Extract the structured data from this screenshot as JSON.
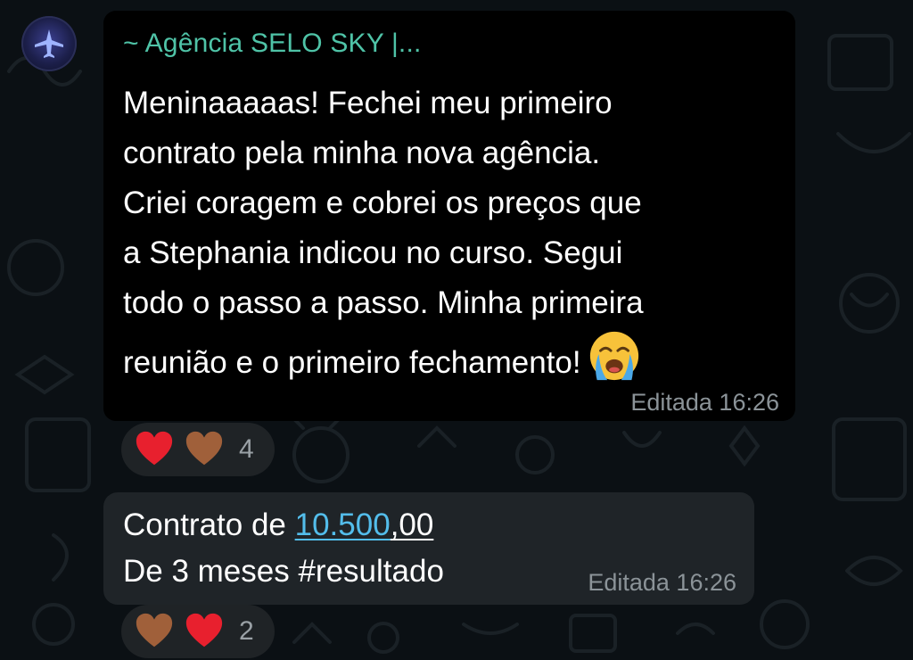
{
  "group": {
    "sender_name": "~ Agência SELO SKY |..."
  },
  "messages": [
    {
      "lines": [
        "Meninaaaaas! Fechei meu primeiro",
        "contrato pela minha nova agência.",
        "Criei coragem e cobrei os preços que",
        "a Stephania indicou no curso. Segui",
        "todo o passo a passo. Minha primeira",
        "reunião e o primeiro fechamento!"
      ],
      "emoji": "loudly-crying-face",
      "status": "Editada 16:26",
      "reactions": {
        "emojis": [
          "red-heart",
          "brown-heart"
        ],
        "count": "4"
      }
    },
    {
      "line1_prefix": "Contrato de ",
      "line1_link": "10.500",
      "line1_suffix": ",00",
      "line2": "De 3 meses #resultado",
      "status": "Editada 16:26",
      "reactions": {
        "emojis": [
          "brown-heart",
          "red-heart"
        ],
        "count": "2"
      }
    }
  ],
  "colors": {
    "background": "#0b1014",
    "bubble_main": "#000000",
    "bubble_second": "#1f2428",
    "sender_name": "#4fc3a7",
    "link": "#53bdeb",
    "meta": "#8b9398"
  }
}
